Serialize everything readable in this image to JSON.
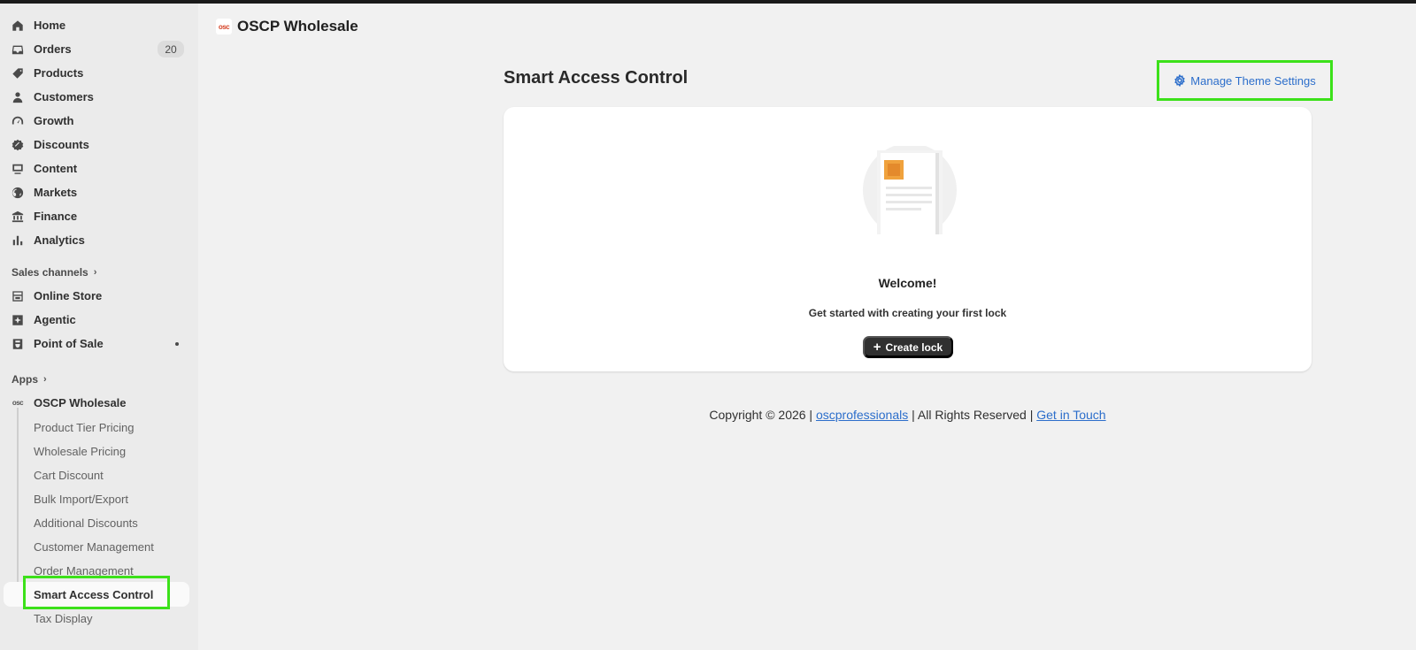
{
  "sidebar": {
    "items": [
      {
        "label": "Home",
        "icon": "home-icon"
      },
      {
        "label": "Orders",
        "icon": "inbox-icon",
        "badge": "20"
      },
      {
        "label": "Products",
        "icon": "tag-icon"
      },
      {
        "label": "Customers",
        "icon": "person-icon"
      },
      {
        "label": "Growth",
        "icon": "gauge-icon"
      },
      {
        "label": "Discounts",
        "icon": "discount-icon"
      },
      {
        "label": "Content",
        "icon": "content-icon"
      },
      {
        "label": "Markets",
        "icon": "globe-icon"
      },
      {
        "label": "Finance",
        "icon": "bank-icon"
      },
      {
        "label": "Analytics",
        "icon": "bar-chart-icon"
      }
    ],
    "sales_channels_label": "Sales channels",
    "channels": [
      {
        "label": "Online Store",
        "icon": "store-icon"
      },
      {
        "label": "Agentic",
        "icon": "agentic-icon"
      },
      {
        "label": "Point of Sale",
        "icon": "pos-icon"
      }
    ],
    "apps_label": "Apps",
    "app_name": "OSCP Wholesale",
    "app_subitems": [
      "Product Tier Pricing",
      "Wholesale Pricing",
      "Cart Discount",
      "Bulk Import/Export",
      "Additional Discounts",
      "Customer Management",
      "Order Management",
      "Smart Access Control",
      "Tax Display"
    ],
    "active_subitem": "Smart Access Control"
  },
  "header": {
    "logo_text": "osc",
    "app_title": "OSCP Wholesale"
  },
  "main": {
    "page_title": "Smart Access Control",
    "manage_link": "Manage Theme Settings",
    "card": {
      "welcome": "Welcome!",
      "subtitle": "Get started with creating your first lock",
      "button": "Create lock"
    }
  },
  "footer": {
    "copyright": "Copyright © 2026 |",
    "company_link": "oscprofessionals",
    "rights": "| All Rights Reserved |",
    "contact_link": "Get in Touch"
  },
  "colors": {
    "highlight": "#3ce11a",
    "link": "#2c6ecb",
    "button": "#303030"
  }
}
